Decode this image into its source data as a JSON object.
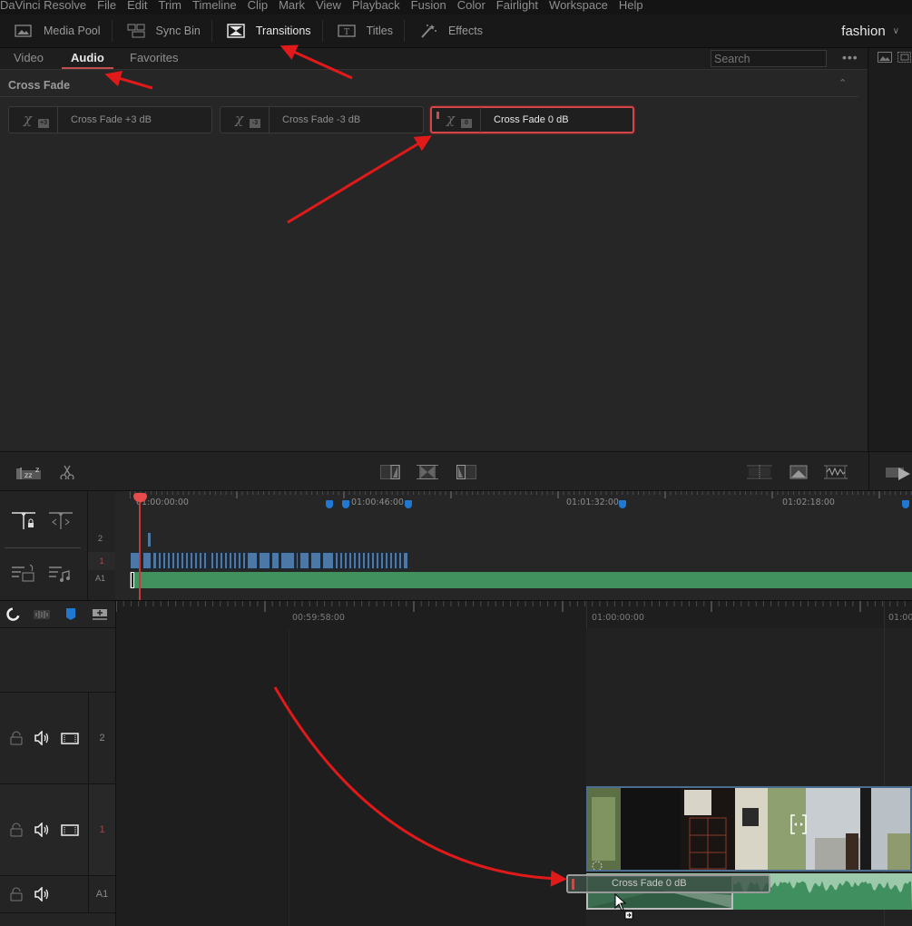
{
  "menu": [
    "DaVinci Resolve",
    "File",
    "Edit",
    "Trim",
    "Timeline",
    "Clip",
    "Mark",
    "View",
    "Playback",
    "Fusion",
    "Color",
    "Fairlight",
    "Workspace",
    "Help"
  ],
  "toolbar": {
    "media_pool": "Media Pool",
    "sync_bin": "Sync Bin",
    "transitions": "Transitions",
    "titles": "Titles",
    "effects": "Effects",
    "project_name": "fashion"
  },
  "panel": {
    "tabs": [
      "Video",
      "Audio",
      "Favorites"
    ],
    "active_tab": "Audio",
    "search_placeholder": "Search",
    "section_title": "Cross Fade",
    "tiles": [
      {
        "label": "Cross Fade +3 dB",
        "badge": "+3"
      },
      {
        "label": "Cross Fade -3 dB",
        "badge": "-3"
      },
      {
        "label": "Cross Fade 0 dB",
        "badge": "0",
        "selected": true
      }
    ]
  },
  "mini_timeline": {
    "timecodes": [
      "01:00:00:00",
      "01:00:46:00",
      "01:01:32:00",
      "01:02:18:00"
    ],
    "tracks": [
      "2",
      "1",
      "A1"
    ]
  },
  "timeline": {
    "timecodes": [
      "00:59:58:00",
      "01:00:00:00",
      "01:00"
    ],
    "tracks": [
      {
        "label": "2",
        "type": "video"
      },
      {
        "label": "1",
        "type": "video"
      },
      {
        "label": "A1",
        "type": "audio"
      }
    ],
    "drag_label": "Cross Fade 0 dB"
  },
  "colors": {
    "accent_red": "#c0504d",
    "playhead": "#e84b4b",
    "marker_blue": "#1f78d1",
    "video_clip": "#4c78a8",
    "audio_clip": "#3f8f5f"
  }
}
